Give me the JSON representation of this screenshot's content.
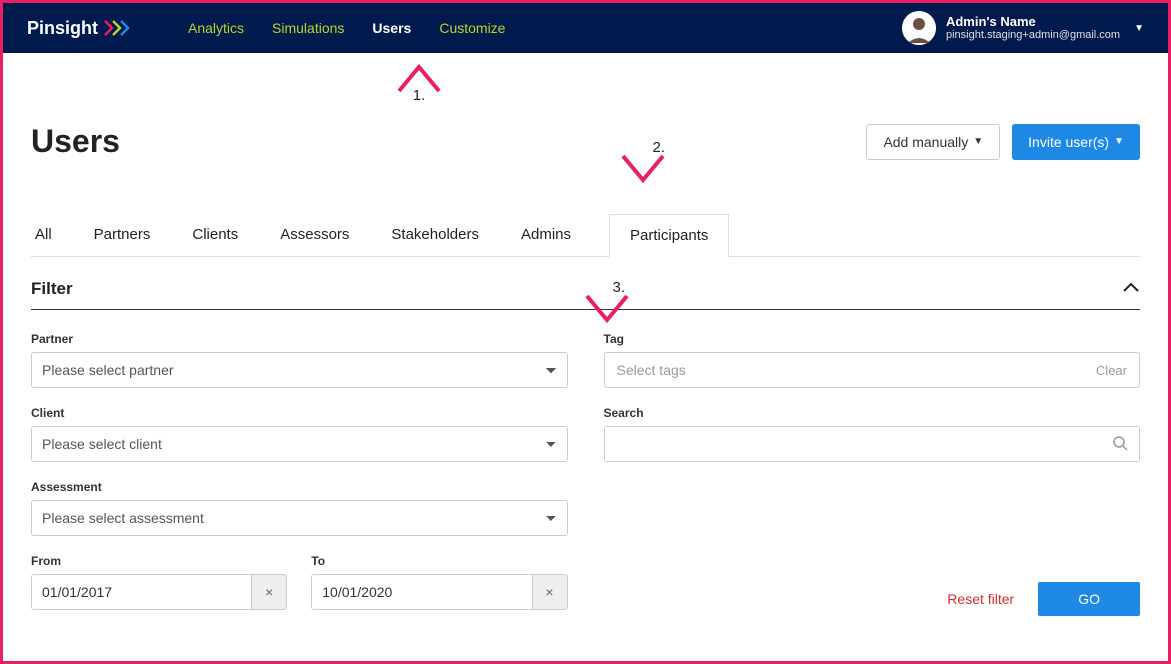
{
  "brand": "Pinsight",
  "nav": {
    "analytics": "Analytics",
    "simulations": "Simulations",
    "users": "Users",
    "customize": "Customize"
  },
  "user": {
    "name": "Admin's Name",
    "email": "pinsight.staging+admin@gmail.com"
  },
  "page": {
    "title": "Users"
  },
  "actions": {
    "add_manually": "Add manually",
    "invite": "Invite user(s)"
  },
  "tabs": {
    "all": "All",
    "partners": "Partners",
    "clients": "Clients",
    "assessors": "Assessors",
    "stakeholders": "Stakeholders",
    "admins": "Admins",
    "participants": "Participants"
  },
  "filter": {
    "title": "Filter",
    "partner_label": "Partner",
    "partner_placeholder": "Please select partner",
    "client_label": "Client",
    "client_placeholder": "Please select client",
    "assessment_label": "Assessment",
    "assessment_placeholder": "Please select assessment",
    "from_label": "From",
    "from_value": "01/01/2017",
    "to_label": "To",
    "to_value": "10/01/2020",
    "tag_label": "Tag",
    "tag_placeholder": "Select tags",
    "tag_clear": "Clear",
    "search_label": "Search",
    "reset": "Reset filter",
    "go": "GO"
  },
  "annotations": {
    "a1": "1.",
    "a2": "2.",
    "a3": "3."
  }
}
